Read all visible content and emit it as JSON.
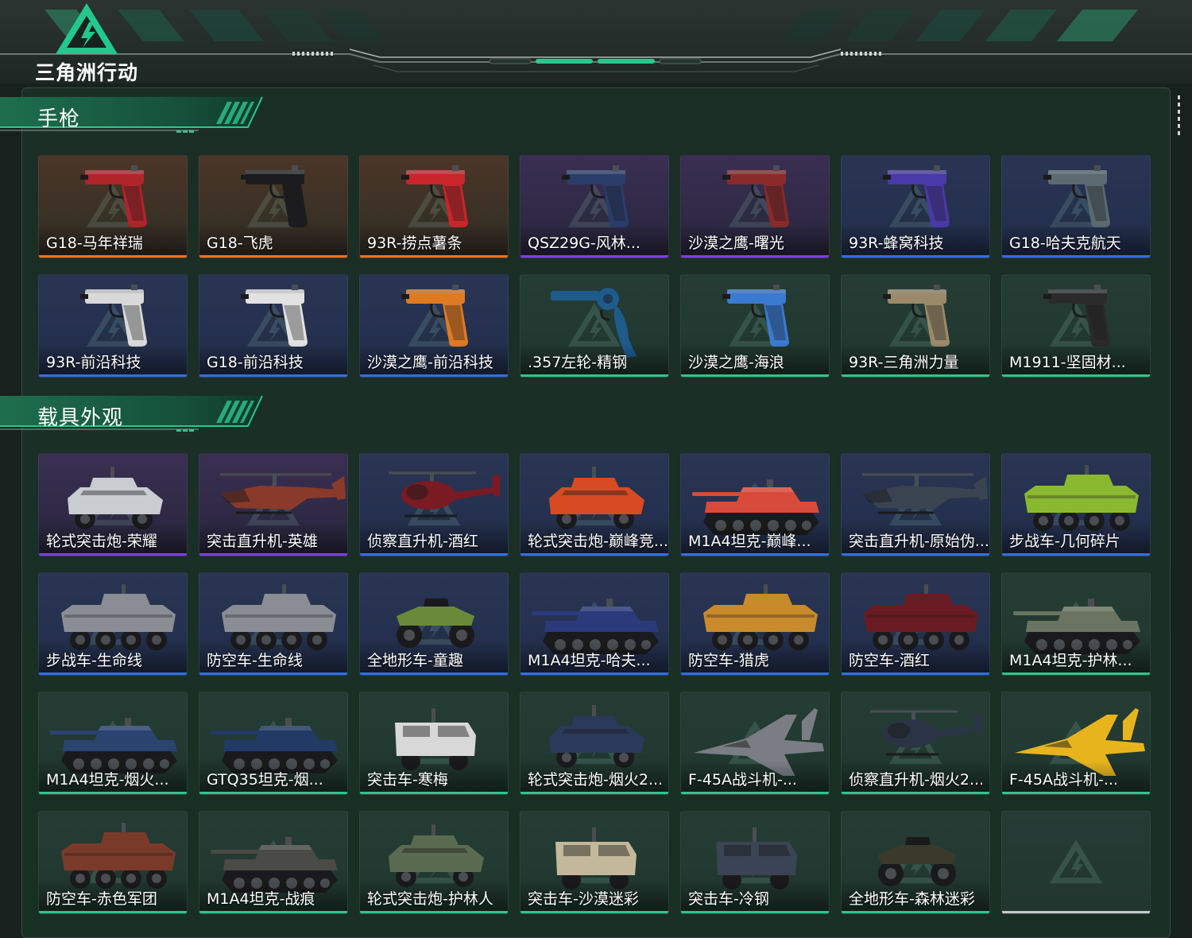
{
  "app": {
    "title": "三角洲行动"
  },
  "colors": {
    "accent": "#2fc58c",
    "quality_orange": "#e8741e",
    "quality_purple": "#7a3fe0",
    "quality_blue": "#2f6fe4",
    "quality_green": "#2fc58c"
  },
  "sections": [
    {
      "title": "手枪",
      "items": [
        {
          "name": "G18-马年祥瑞",
          "quality": "orange",
          "kind": "pistol",
          "color": "#b0252a"
        },
        {
          "name": "G18-飞虎",
          "quality": "orange",
          "kind": "pistol",
          "color": "#1c1c1e"
        },
        {
          "name": "93R-捞点薯条",
          "quality": "orange",
          "kind": "pistol",
          "color": "#c8262a"
        },
        {
          "name": "QSZ29G-风林...",
          "quality": "purple",
          "kind": "pistol",
          "color": "#2a3d6a"
        },
        {
          "name": "沙漠之鹰-曙光",
          "quality": "purple",
          "kind": "pistol",
          "color": "#8a2a2a"
        },
        {
          "name": "93R-蜂窝科技",
          "quality": "blue",
          "kind": "pistol",
          "color": "#4a3aa8"
        },
        {
          "name": "G18-哈夫克航天",
          "quality": "blue",
          "kind": "pistol",
          "color": "#5a6a70"
        },
        {
          "name": "93R-前沿科技",
          "quality": "blue",
          "kind": "pistol",
          "color": "#d9d9d9"
        },
        {
          "name": "G18-前沿科技",
          "quality": "blue",
          "kind": "pistol",
          "color": "#e2e2e2"
        },
        {
          "name": "沙漠之鹰-前沿科技",
          "quality": "blue",
          "kind": "pistol",
          "color": "#e07a22"
        },
        {
          "name": ".357左轮-精钢",
          "quality": "green",
          "kind": "revolver",
          "color": "#1e5a8a"
        },
        {
          "name": "沙漠之鹰-海浪",
          "quality": "green",
          "kind": "pistol",
          "color": "#3a7ad0"
        },
        {
          "name": "93R-三角洲力量",
          "quality": "green",
          "kind": "pistol",
          "color": "#9a8a6a"
        },
        {
          "name": "M1911-坚固材...",
          "quality": "green",
          "kind": "pistol",
          "color": "#2a2a2a"
        }
      ]
    },
    {
      "title": "载具外观",
      "items": [
        {
          "name": "轮式突击炮-荣耀",
          "quality": "purple",
          "kind": "armored-car",
          "color": "#c9ccd0"
        },
        {
          "name": "突击直升机-英雄",
          "quality": "purple",
          "kind": "helicopter",
          "color": "#8a3a2a"
        },
        {
          "name": "侦察直升机-酒红",
          "quality": "blue",
          "kind": "scout-heli",
          "color": "#7a1a22"
        },
        {
          "name": "轮式突击炮-巅峰竞...",
          "quality": "blue",
          "kind": "armored-car",
          "color": "#d84a22"
        },
        {
          "name": "M1A4坦克-巅峰...",
          "quality": "blue",
          "kind": "tank",
          "color": "#d84a3a"
        },
        {
          "name": "突击直升机-原始伪...",
          "quality": "blue",
          "kind": "helicopter",
          "color": "#3a4450"
        },
        {
          "name": "步战车-几何碎片",
          "quality": "blue",
          "kind": "apc",
          "color": "#8ab830"
        },
        {
          "name": "步战车-生命线",
          "quality": "blue",
          "kind": "apc",
          "color": "#8a8e94"
        },
        {
          "name": "防空车-生命线",
          "quality": "blue",
          "kind": "apc",
          "color": "#8a8e94"
        },
        {
          "name": "全地形车-童趣",
          "quality": "blue",
          "kind": "atv",
          "color": "#6a8a3a"
        },
        {
          "name": "M1A4坦克-哈夫...",
          "quality": "blue",
          "kind": "tank",
          "color": "#2a3a7a"
        },
        {
          "name": "防空车-猎虎",
          "quality": "blue",
          "kind": "apc",
          "color": "#c88a2a"
        },
        {
          "name": "防空车-酒红",
          "quality": "blue",
          "kind": "apc",
          "color": "#6a1a22"
        },
        {
          "name": "M1A4坦克-护林...",
          "quality": "green",
          "kind": "tank",
          "color": "#6a7460"
        },
        {
          "name": "M1A4坦克-烟火...",
          "quality": "green",
          "kind": "tank",
          "color": "#2a4470"
        },
        {
          "name": "GTQ35坦克-烟...",
          "quality": "green",
          "kind": "tank",
          "color": "#223a66"
        },
        {
          "name": "突击车-寒梅",
          "quality": "green",
          "kind": "truck",
          "color": "#d8d8d8"
        },
        {
          "name": "轮式突击炮-烟火2...",
          "quality": "green",
          "kind": "armored-car",
          "color": "#2a3a5a"
        },
        {
          "name": "F-45A战斗机-...",
          "quality": "green",
          "kind": "jet",
          "color": "#7a7e84"
        },
        {
          "name": "侦察直升机-烟火2...",
          "quality": "green",
          "kind": "scout-heli",
          "color": "#2a3444"
        },
        {
          "name": "F-45A战斗机-...",
          "quality": "green",
          "kind": "jet",
          "color": "#e8b41e"
        },
        {
          "name": "防空车-赤色军团",
          "quality": "green",
          "kind": "apc",
          "color": "#7a3a2a"
        },
        {
          "name": "M1A4坦克-战痕",
          "quality": "green",
          "kind": "tank",
          "color": "#4a4a46"
        },
        {
          "name": "轮式突击炮-护林人",
          "quality": "green",
          "kind": "armored-car",
          "color": "#5a6a50"
        },
        {
          "name": "突击车-沙漠迷彩",
          "quality": "green",
          "kind": "truck",
          "color": "#c4b89a"
        },
        {
          "name": "突击车-冷钢",
          "quality": "green",
          "kind": "truck",
          "color": "#3a4454"
        },
        {
          "name": "全地形车-森林迷彩",
          "quality": "green",
          "kind": "atv",
          "color": "#3a3a2a"
        },
        {
          "name": "",
          "quality": "empty",
          "kind": "empty",
          "color": "#22362f"
        }
      ]
    }
  ]
}
